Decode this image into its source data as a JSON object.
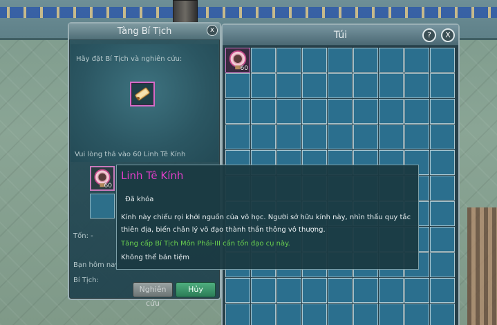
{
  "left_panel": {
    "title": "Tàng Bí Tịch",
    "close_label": "x",
    "instruction": "Hãy đặt Bí Tịch và nghiên cứu:",
    "hint": "Vui lòng thả vào 60  Linh Tê Kính",
    "book_slot_qty": "60",
    "cost_label": "Tốn: -",
    "today_label": "Bạn hôm nay",
    "book_label": "Bí Tịch:",
    "research_button": "Nghiên cứu",
    "cancel_button": "Hủy"
  },
  "bag": {
    "title": "Túi",
    "help_label": "?",
    "close_label": "X",
    "rows": 11,
    "cols": 9,
    "items": [
      {
        "index": 0,
        "qty": "60",
        "name": "Linh Tê Kính"
      }
    ]
  },
  "tooltip": {
    "name": "Linh Tê Kính",
    "status": "Đã khóa",
    "desc_line1": "Kính này chiếu rọi khởi nguồn của võ học. Người sở hữu kính này, nhìn thấu quy tắc",
    "desc_line2": "thiên địa, biến chân lý võ đạo thành thần thông vô thượng.",
    "use_note": "Tăng cấp Bí Tịch Môn Phái-III cần tốn đạo cụ này.",
    "sell_note": "Không thể bán tiệm"
  },
  "colors": {
    "item_name": "#e13fc9",
    "use_note": "#6ad04f",
    "slot_border": "#d46bc6"
  }
}
